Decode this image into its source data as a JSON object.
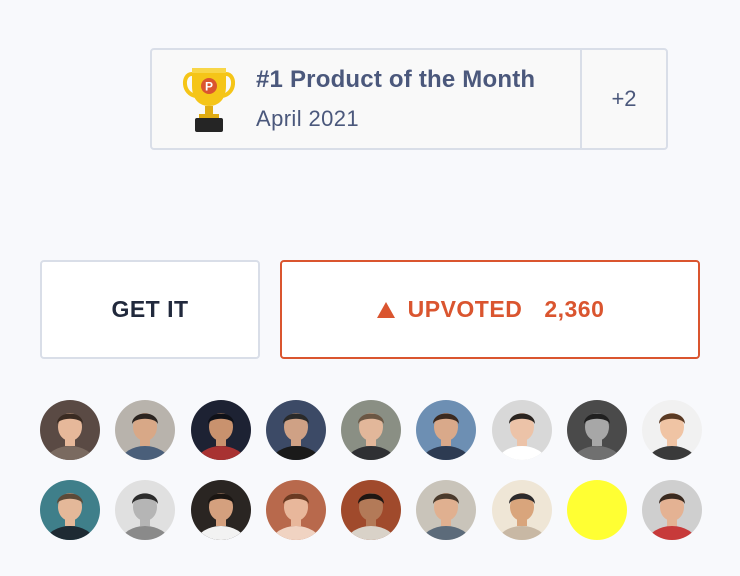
{
  "award": {
    "title": "#1 Product of the Month",
    "subtitle": "April 2021",
    "more": "+2",
    "trophy_icon": "trophy-icon",
    "trophy_letter": "P"
  },
  "actions": {
    "get_label": "GET IT",
    "upvote_label": "UPVOTED",
    "upvote_count": "2,360",
    "upvote_icon": "triangle-up-icon"
  },
  "colors": {
    "accent": "#da552f",
    "text_muted": "#4b587c",
    "text_dark": "#21293c",
    "border": "#d9dee8",
    "background": "#f8f9fc",
    "trophy_gold": "#f5c518"
  },
  "upvoters": [
    {
      "bg": "#5a4a44",
      "skin": "#e6b89a",
      "hair": "#3a2b22",
      "shirt": "#7a6a60"
    },
    {
      "bg": "#b8b3ac",
      "skin": "#d8a887",
      "hair": "#2b2420",
      "shirt": "#4a5f7a"
    },
    {
      "bg": "#1d2233",
      "skin": "#c9926e",
      "hair": "#0f1118",
      "shirt": "#a83232"
    },
    {
      "bg": "#3c4a66",
      "skin": "#cfa185",
      "hair": "#2a2a2a",
      "shirt": "#1a1a1a"
    },
    {
      "bg": "#8a8f84",
      "skin": "#e2b79a",
      "hair": "#6b5744",
      "shirt": "#2f3033"
    },
    {
      "bg": "#6d8fb3",
      "skin": "#d9a98a",
      "hair": "#3b2a20",
      "shirt": "#2d3b52"
    },
    {
      "bg": "#d8d8d8",
      "skin": "#ecc3a8",
      "hair": "#2a2420",
      "shirt": "#ffffff"
    },
    {
      "bg": "#4a4a4a",
      "skin": "#a7a7a7",
      "hair": "#202020",
      "shirt": "#707070"
    },
    {
      "bg": "#f1f1f1",
      "skin": "#f0c4a4",
      "hair": "#5a3a24",
      "shirt": "#3a3a3a"
    },
    {
      "bg": "#3f7f8a",
      "skin": "#e4b899",
      "hair": "#5c4a38",
      "shirt": "#1e2a33"
    },
    {
      "bg": "#e0e0e0",
      "skin": "#b5b5b5",
      "hair": "#2c2c2c",
      "shirt": "#8a8a8a"
    },
    {
      "bg": "#2a2522",
      "skin": "#d4a07e",
      "hair": "#1a1512",
      "shirt": "#f2f2f2"
    },
    {
      "bg": "#b8694c",
      "skin": "#e8b79b",
      "hair": "#6a3a22",
      "shirt": "#f0d3c2"
    },
    {
      "bg": "#a04a2c",
      "skin": "#b37a58",
      "hair": "#1e1612",
      "shirt": "#d9d2c8"
    },
    {
      "bg": "#c9c4ba",
      "skin": "#e0b090",
      "hair": "#4a3a2c",
      "shirt": "#5c6b7a"
    },
    {
      "bg": "#efe6d6",
      "skin": "#d9a57c",
      "hair": "#2c2a2c",
      "shirt": "#c8b8a4"
    },
    {
      "bg": "#ffff33",
      "skin": "#ffff33",
      "hair": "#ffff33",
      "shirt": "#ffff33",
      "plain": true
    },
    {
      "bg": "#cfcfcf",
      "skin": "#e4b293",
      "hair": "#3a2a20",
      "shirt": "#c73a3a"
    }
  ]
}
